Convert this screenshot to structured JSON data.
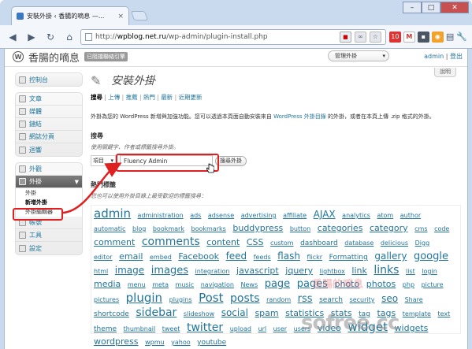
{
  "browser": {
    "tab_title": "安裝外掛 ‹ 香腸的嘀息 —...",
    "tab_close": "×",
    "url_prefix": "http://",
    "url_host": "wpblog.net.ru",
    "url_path": "/wp-admin/plugin-install.php",
    "badge_count": "10"
  },
  "wp": {
    "site_name": "香腸的嘀息",
    "visit_site": "已阻擋聯絡引擎",
    "favorites": "管理外掛",
    "howdy_user": "admin",
    "logout": "登出",
    "help": "說明"
  },
  "sidebar": {
    "dashboard": "控制台",
    "posts": "文章",
    "media": "媒體",
    "links": "鏈結",
    "pages": "網誌分頁",
    "comments": "迴響",
    "appearance": "外觀",
    "plugins": "外掛",
    "sub_plugins": "外掛",
    "sub_addnew": "新增外掛",
    "sub_editor": "外掛編輯器",
    "users": "帳號",
    "tools": "工具",
    "settings": "設定"
  },
  "main": {
    "title": "安裝外掛",
    "subnav": [
      "搜尋",
      "上傳",
      "推薦",
      "熱門",
      "最新",
      "近期更新"
    ],
    "description_1": "外掛為您的 WordPress 新增與加強功能。您可以透過本頁面自動安裝來自",
    "description_link": "WordPress 外掛目錄",
    "description_2": "的外掛，或者在本頁上傳 .zip 格式的外掛。",
    "search_heading": "搜尋",
    "search_hint": "使用關鍵字、作者或標籤搜尋外掛。",
    "search_type": "項目",
    "search_value": "Fluency Admin",
    "search_button": "搜尋外掛",
    "popular_heading": "熱門標籤",
    "popular_hint": "您也可以使用外掛目錄上最受歡迎的標籤搜尋："
  },
  "tags": [
    {
      "t": "admin",
      "s": 15
    },
    {
      "t": "administration",
      "s": 8
    },
    {
      "t": "ads",
      "s": 8
    },
    {
      "t": "adsense",
      "s": 8
    },
    {
      "t": "advertising",
      "s": 8
    },
    {
      "t": "affiliate",
      "s": 8
    },
    {
      "t": "AJAX",
      "s": 12
    },
    {
      "t": "analytics",
      "s": 8
    },
    {
      "t": "atom",
      "s": 8
    },
    {
      "t": "author",
      "s": 8
    },
    {
      "t": "automatic",
      "s": 8
    },
    {
      "t": "blog",
      "s": 8
    },
    {
      "t": "bookmark",
      "s": 8
    },
    {
      "t": "bookmarks",
      "s": 8
    },
    {
      "t": "buddypress",
      "s": 11
    },
    {
      "t": "button",
      "s": 8
    },
    {
      "t": "categories",
      "s": 11
    },
    {
      "t": "category",
      "s": 11
    },
    {
      "t": "cms",
      "s": 8
    },
    {
      "t": "code",
      "s": 8
    },
    {
      "t": "comment",
      "s": 11
    },
    {
      "t": "comments",
      "s": 14
    },
    {
      "t": "content",
      "s": 11
    },
    {
      "t": "CSS",
      "s": 11
    },
    {
      "t": "custom",
      "s": 8
    },
    {
      "t": "dashboard",
      "s": 9
    },
    {
      "t": "database",
      "s": 8
    },
    {
      "t": "delicious",
      "s": 8
    },
    {
      "t": "Digg",
      "s": 8
    },
    {
      "t": "editor",
      "s": 8
    },
    {
      "t": "email",
      "s": 11
    },
    {
      "t": "embed",
      "s": 8
    },
    {
      "t": "Facebook",
      "s": 11
    },
    {
      "t": "feed",
      "s": 12
    },
    {
      "t": "feeds",
      "s": 8
    },
    {
      "t": "flash",
      "s": 12
    },
    {
      "t": "flickr",
      "s": 8
    },
    {
      "t": "Formatting",
      "s": 9
    },
    {
      "t": "gallery",
      "s": 12
    },
    {
      "t": "google",
      "s": 13
    },
    {
      "t": "html",
      "s": 8
    },
    {
      "t": "image",
      "s": 12
    },
    {
      "t": "images",
      "s": 13
    },
    {
      "t": "integration",
      "s": 8
    },
    {
      "t": "javascript",
      "s": 11
    },
    {
      "t": "jquery",
      "s": 11
    },
    {
      "t": "lightbox",
      "s": 8
    },
    {
      "t": "link",
      "s": 11
    },
    {
      "t": "links",
      "s": 14
    },
    {
      "t": "list",
      "s": 8
    },
    {
      "t": "login",
      "s": 8
    },
    {
      "t": "media",
      "s": 11
    },
    {
      "t": "menu",
      "s": 8
    },
    {
      "t": "meta",
      "s": 8
    },
    {
      "t": "music",
      "s": 8
    },
    {
      "t": "navigation",
      "s": 8
    },
    {
      "t": "News",
      "s": 8
    },
    {
      "t": "page",
      "s": 13
    },
    {
      "t": "pages",
      "s": 13
    },
    {
      "t": "photo",
      "s": 11
    },
    {
      "t": "photos",
      "s": 11
    },
    {
      "t": "php",
      "s": 8
    },
    {
      "t": "picture",
      "s": 8
    },
    {
      "t": "pictures",
      "s": 8
    },
    {
      "t": "plugin",
      "s": 15
    },
    {
      "t": "plugins",
      "s": 8
    },
    {
      "t": "Post",
      "s": 15
    },
    {
      "t": "posts",
      "s": 14
    },
    {
      "t": "random",
      "s": 8
    },
    {
      "t": "rss",
      "s": 13
    },
    {
      "t": "search",
      "s": 9
    },
    {
      "t": "security",
      "s": 8
    },
    {
      "t": "seo",
      "s": 12
    },
    {
      "t": "Share",
      "s": 8
    },
    {
      "t": "shortcode",
      "s": 9
    },
    {
      "t": "sidebar",
      "s": 14
    },
    {
      "t": "slideshow",
      "s": 8
    },
    {
      "t": "social",
      "s": 12
    },
    {
      "t": "spam",
      "s": 11
    },
    {
      "t": "statistics",
      "s": 11
    },
    {
      "t": "stats",
      "s": 11
    },
    {
      "t": "tag",
      "s": 9
    },
    {
      "t": "tags",
      "s": 11
    },
    {
      "t": "template",
      "s": 8
    },
    {
      "t": "text",
      "s": 8
    },
    {
      "t": "theme",
      "s": 9
    },
    {
      "t": "thumbnail",
      "s": 8
    },
    {
      "t": "tweet",
      "s": 8
    },
    {
      "t": "twitter",
      "s": 14
    },
    {
      "t": "upload",
      "s": 8
    },
    {
      "t": "url",
      "s": 8
    },
    {
      "t": "user",
      "s": 8
    },
    {
      "t": "users",
      "s": 8
    },
    {
      "t": "video",
      "s": 11
    },
    {
      "t": "widget",
      "s": 15
    },
    {
      "t": "widgets",
      "s": 11
    },
    {
      "t": "wordpress",
      "s": 11
    },
    {
      "t": "wpmu",
      "s": 8
    },
    {
      "t": "yahoo",
      "s": 8
    },
    {
      "t": "youtube",
      "s": 9
    }
  ],
  "watermark": "sofree.cc",
  "watermark_cn": "香腸的嘀息",
  "colors": {
    "link": "#21759b",
    "highlight": "#e02020"
  }
}
